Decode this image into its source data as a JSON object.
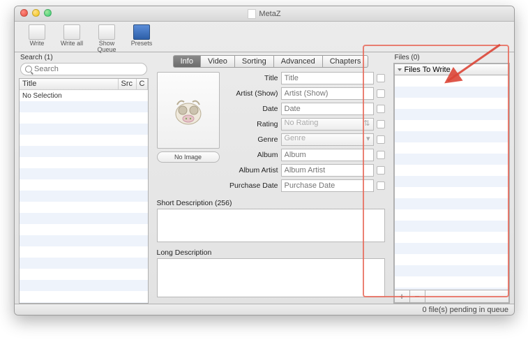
{
  "window": {
    "title": "MetaZ"
  },
  "toolbar": [
    {
      "id": "write",
      "label": "Write"
    },
    {
      "id": "writeall",
      "label": "Write all"
    },
    {
      "id": "showqueue",
      "label": "Show Queue"
    },
    {
      "id": "presets",
      "label": "Presets"
    }
  ],
  "left": {
    "label": "Search (1)",
    "search_placeholder": "Search",
    "columns": {
      "title": "Title",
      "src": "Src",
      "c": "C"
    },
    "row0": "No Selection"
  },
  "tabs": [
    {
      "id": "info",
      "label": "Info",
      "active": true
    },
    {
      "id": "video",
      "label": "Video"
    },
    {
      "id": "sorting",
      "label": "Sorting"
    },
    {
      "id": "advanced",
      "label": "Advanced"
    },
    {
      "id": "chapters",
      "label": "Chapters"
    }
  ],
  "artwork": {
    "no_image_label": "No Image"
  },
  "fields": {
    "title": {
      "label": "Title",
      "placeholder": "Title"
    },
    "artist": {
      "label": "Artist (Show)",
      "placeholder": "Artist (Show)"
    },
    "date": {
      "label": "Date",
      "placeholder": "Date"
    },
    "rating": {
      "label": "Rating",
      "placeholder": "No Rating"
    },
    "genre": {
      "label": "Genre",
      "placeholder": "Genre"
    },
    "album": {
      "label": "Album",
      "placeholder": "Album"
    },
    "album_artist": {
      "label": "Album Artist",
      "placeholder": "Album Artist"
    },
    "purchase_date": {
      "label": "Purchase Date",
      "placeholder": "Purchase Date"
    }
  },
  "desc": {
    "short_label": "Short Description (256)",
    "long_label": "Long Description"
  },
  "right": {
    "label": "Files (0)",
    "header": "Files To Write",
    "add": "+",
    "remove": "−"
  },
  "status": "0 file(s) pending in queue"
}
